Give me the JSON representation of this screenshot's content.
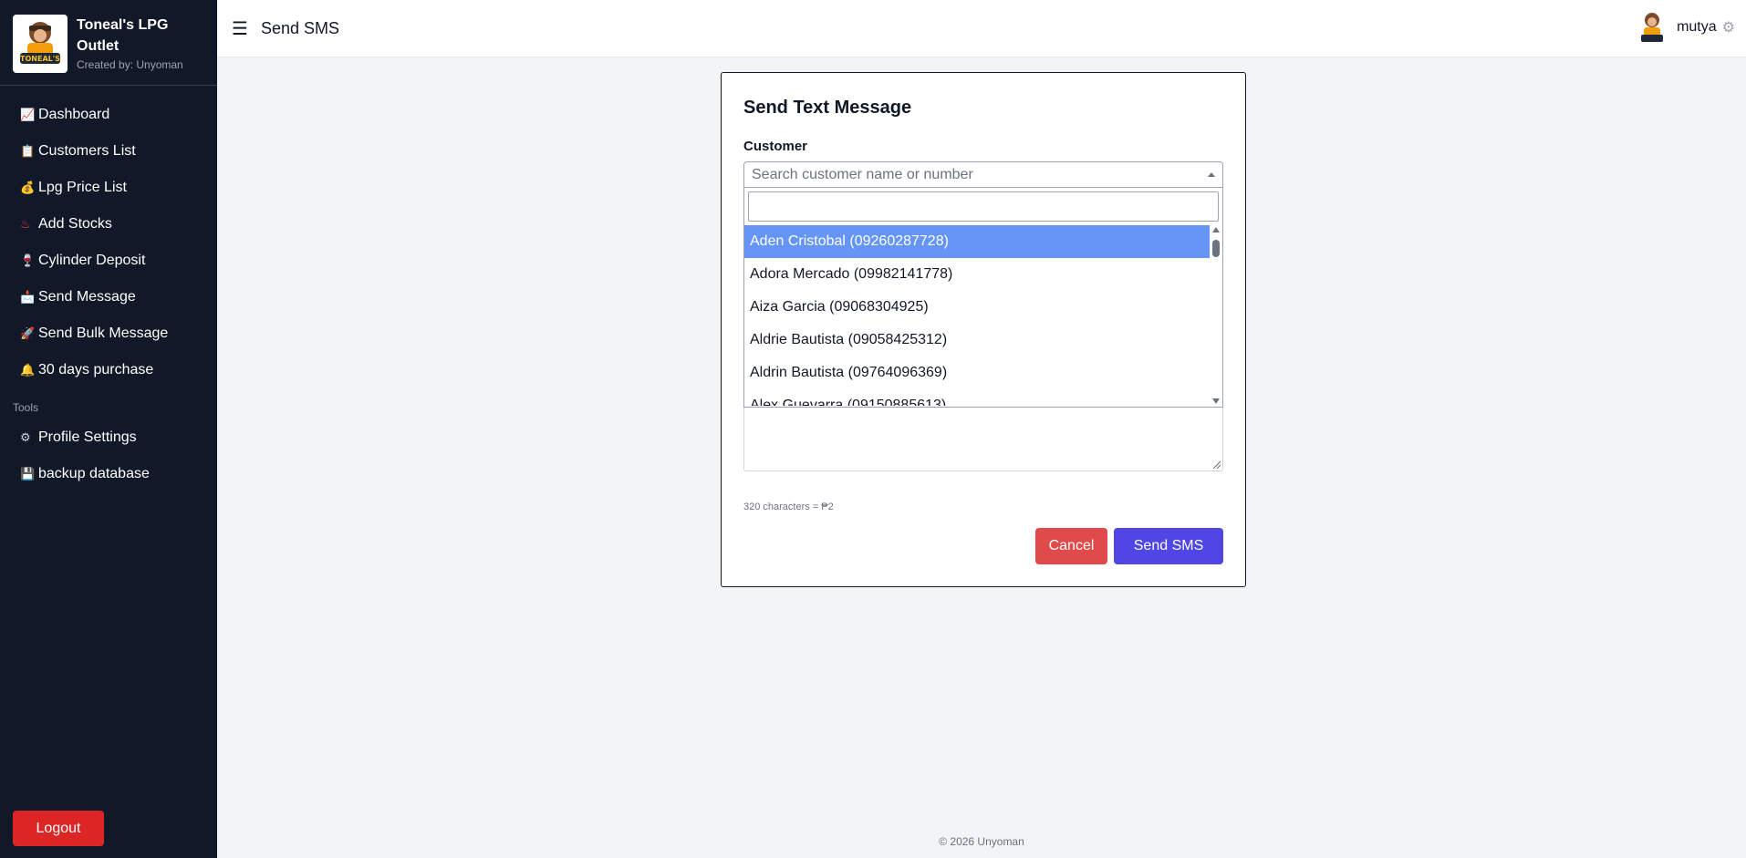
{
  "app": {
    "name": "Toneal's LPG Outlet",
    "subtitle": "Created by: Unyoman",
    "logo_text": "TONEAL'S"
  },
  "sidebar": {
    "items": [
      {
        "icon": "📈",
        "label": "Dashboard"
      },
      {
        "icon": "📋",
        "label": "Customers List"
      },
      {
        "icon": "💰",
        "label": "Lpg Price List"
      },
      {
        "icon": "♨",
        "label": "Add Stocks"
      },
      {
        "icon": "🍷",
        "label": "Cylinder Deposit"
      },
      {
        "icon": "📩",
        "label": "Send Message"
      },
      {
        "icon": "🚀",
        "label": "Send Bulk Message"
      },
      {
        "icon": "🔔",
        "label": "30 days purchase"
      }
    ],
    "section_tools": "Tools",
    "tools": [
      {
        "icon": "⚙",
        "label": "Profile Settings"
      },
      {
        "icon": "💾",
        "label": "backup database"
      }
    ],
    "logout_label": "Logout"
  },
  "topbar": {
    "menu_icon": "☰",
    "title": "Send SMS",
    "user_name": "mutya"
  },
  "form": {
    "title": "Send Text Message",
    "customer_label": "Customer",
    "customer_placeholder": "Search customer name or number",
    "dropdown_search_value": "",
    "options": [
      "Aden Cristobal (09260287728)",
      "Adora Mercado (09982141778)",
      "Aiza Garcia (09068304925)",
      "Aldrie Bautista (09058425312)",
      "Aldrin Bautista (09764096369)",
      "Alex Guevarra (09150885613)"
    ],
    "selected_index": 0,
    "char_info": "320 characters = ₱2",
    "cancel_label": "Cancel",
    "send_label": "Send SMS"
  },
  "footer": {
    "text": "© 2026 Unyoman"
  }
}
